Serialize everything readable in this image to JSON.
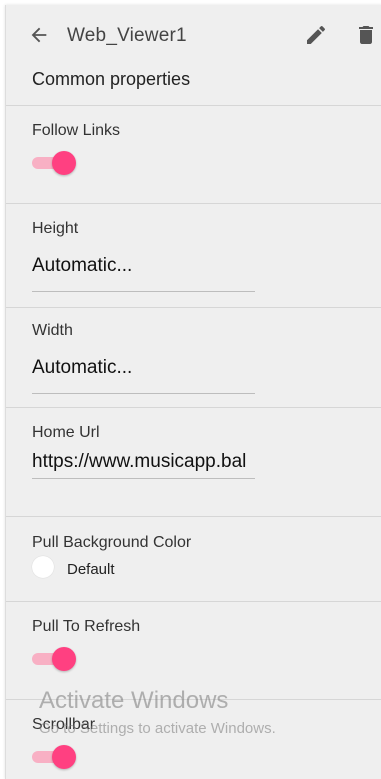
{
  "header": {
    "title": "Web_Viewer1",
    "back_icon": "arrow-left-icon",
    "edit_icon": "pencil-icon",
    "delete_icon": "trash-icon"
  },
  "section_heading": "Common properties",
  "properties": {
    "follow_links": {
      "label": "Follow Links",
      "on": true
    },
    "height": {
      "label": "Height",
      "value": "Automatic..."
    },
    "width": {
      "label": "Width",
      "value": "Automatic..."
    },
    "home_url": {
      "label": "Home Url",
      "value": "https://www.musicapp.bal"
    },
    "pull_background_color": {
      "label": "Pull Background Color",
      "value": "Default",
      "color": "#ffffff"
    },
    "pull_to_refresh": {
      "label": "Pull To Refresh",
      "on": true
    },
    "scrollbar": {
      "label": "Scrollbar",
      "on": true
    }
  },
  "colors": {
    "accent": "#ff4081",
    "accent_track": "#f8b0c4",
    "panel_bg": "#efefef"
  },
  "watermark": {
    "title": "Activate Windows",
    "subtitle": "Go to Settings to activate Windows."
  }
}
